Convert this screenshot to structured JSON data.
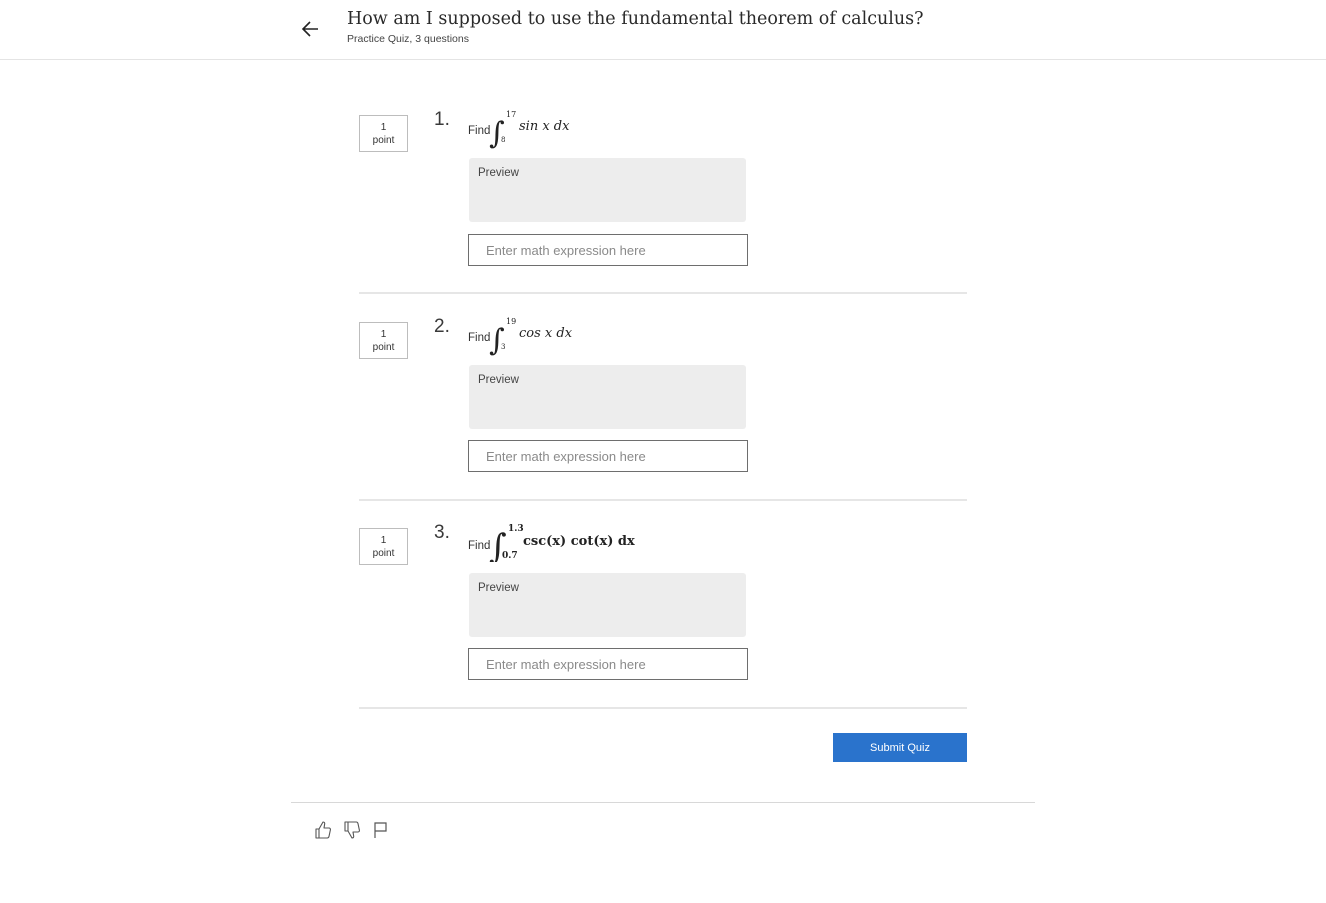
{
  "header": {
    "back_icon": "arrow-left-icon",
    "title": "How am I supposed to use the fundamental theorem of calculus?",
    "subtitle": "Practice Quiz, 3 questions"
  },
  "questions": [
    {
      "points_value": "1",
      "points_label": "point",
      "number": "1.",
      "find_label": "Find",
      "integral": {
        "lower": "8",
        "upper": "17",
        "integrand": "sin x dx"
      },
      "preview_label": "Preview",
      "input_placeholder": "Enter math expression here",
      "input_value": ""
    },
    {
      "points_value": "1",
      "points_label": "point",
      "number": "2.",
      "find_label": "Find",
      "integral": {
        "lower": "3",
        "upper": "19",
        "integrand": "cos x dx"
      },
      "preview_label": "Preview",
      "input_placeholder": "Enter math expression here",
      "input_value": ""
    },
    {
      "points_value": "1",
      "points_label": "point",
      "number": "3.",
      "find_label": "Find",
      "integral": {
        "lower": "0.7",
        "upper": "1.3",
        "integrand": "csc(x) cot(x) dx"
      },
      "preview_label": "Preview",
      "input_placeholder": "Enter math expression here",
      "input_value": ""
    }
  ],
  "submit_label": "Submit Quiz",
  "footer_icons": [
    "thumbs-up-icon",
    "thumbs-down-icon",
    "flag-icon"
  ],
  "colors": {
    "accent": "#2a73cc",
    "preview_bg": "#ededed"
  }
}
